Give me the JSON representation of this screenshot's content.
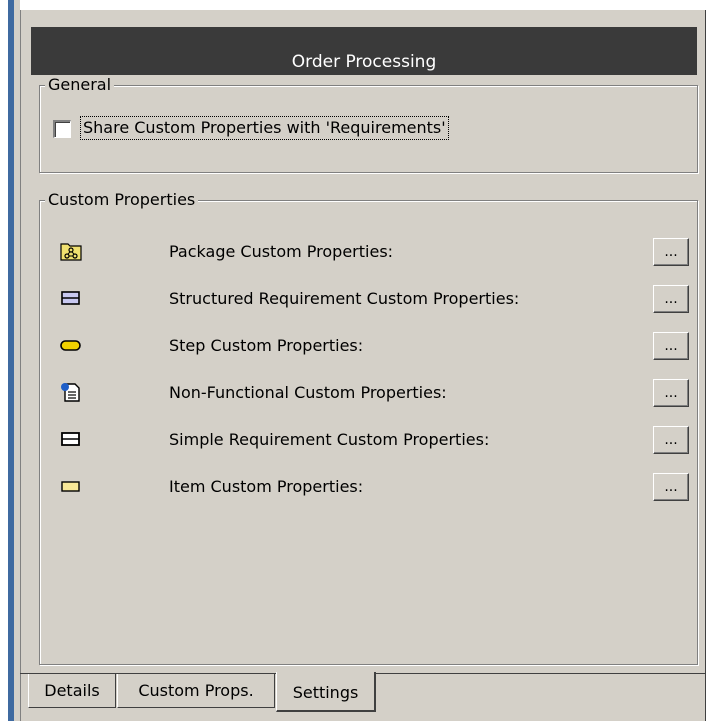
{
  "window": {
    "title": "Order Processing"
  },
  "general": {
    "legend": "General",
    "share_checkbox_label": "Share Custom Properties with 'Requirements'",
    "share_checked": false
  },
  "custom_properties": {
    "legend": "Custom Properties",
    "rows": [
      {
        "icon": "package-icon",
        "label": "Package Custom Properties:",
        "button": "..."
      },
      {
        "icon": "structured-requirement-icon",
        "label": "Structured Requirement Custom Properties:",
        "button": "..."
      },
      {
        "icon": "step-icon",
        "label": "Step Custom Properties:",
        "button": "..."
      },
      {
        "icon": "non-functional-requirement-icon",
        "label": "Non-Functional Custom Properties:",
        "button": "..."
      },
      {
        "icon": "simple-requirement-icon",
        "label": "Simple Requirement Custom Properties:",
        "button": "..."
      },
      {
        "icon": "item-icon",
        "label": "Item Custom Properties:",
        "button": "..."
      }
    ]
  },
  "tabs": [
    {
      "label": "Details",
      "active": false
    },
    {
      "label": "Custom Props.",
      "active": false
    },
    {
      "label": "Settings",
      "active": true
    }
  ],
  "colors": {
    "panel_bg": "#d4d0c8",
    "titlebar_bg": "#3a3a3a",
    "titlebar_text": "#ffffff",
    "left_accent": "#3f6aa0",
    "package_icon": "#f0e070",
    "structured_req_icon": "#c8c8f0",
    "step_icon": "#f0d000",
    "simple_req_icon": "#ffffff",
    "item_icon": "#f8e898"
  }
}
